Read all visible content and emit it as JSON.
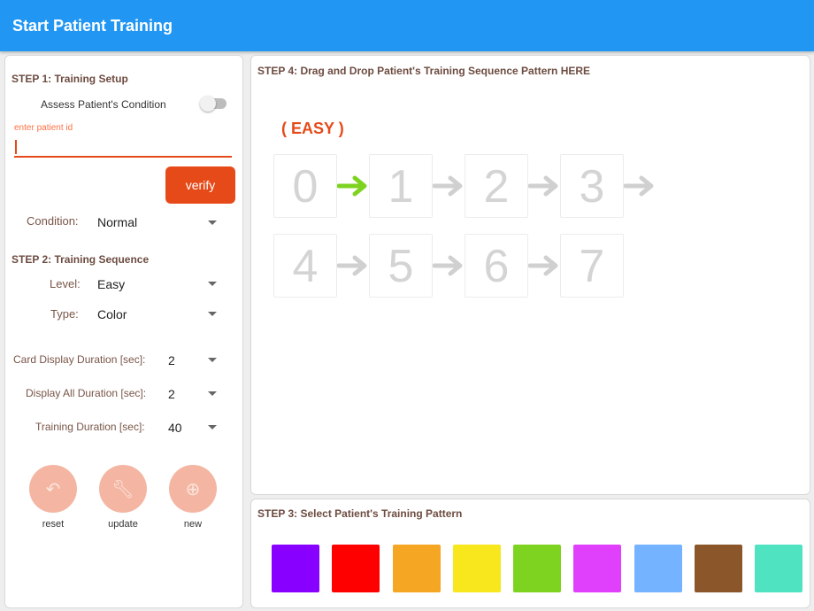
{
  "header": {
    "title": "Start Patient Training"
  },
  "setup": {
    "step1_title": "STEP 1: Training Setup",
    "assess_label": "Assess Patient's Condition",
    "assess_on": false,
    "patient_id_placeholder": "enter patient id",
    "patient_id_value": "",
    "verify_label": "verify",
    "condition_label": "Condition:",
    "condition_value": "Normal",
    "step2_title": "STEP 2: Training Sequence",
    "level_label": "Level:",
    "level_value": "Easy",
    "type_label": "Type:",
    "type_value": "Color",
    "card_display_label": "Card Display Duration [sec]:",
    "card_display_value": "2",
    "display_all_label": "Display All Duration [sec]:",
    "display_all_value": "2",
    "training_label": "Training Duration [sec]:",
    "training_value": "40",
    "buttons": [
      {
        "label": "reset",
        "icon": "undo-icon"
      },
      {
        "label": "update",
        "icon": "wrench-icon"
      },
      {
        "label": "new",
        "icon": "add-circle-icon"
      }
    ]
  },
  "sequence": {
    "step4_title": "STEP 4: Drag and Drop Patient's Training Sequence Pattern HERE",
    "level_badge": "( EASY )",
    "cards": [
      "0",
      "1",
      "2",
      "3",
      "4",
      "5",
      "6",
      "7"
    ],
    "active_arrow_index": 0
  },
  "pattern": {
    "step3_title": "STEP 3: Select Patient's Training Pattern",
    "colors": [
      "#8800ff",
      "#ff0000",
      "#f5a623",
      "#f8e71c",
      "#7ed321",
      "#e040fb",
      "#74b3ff",
      "#8b572a",
      "#50e3c2"
    ]
  },
  "theme": {
    "primary": "#2196f3",
    "accent": "#e64a19",
    "arrow_active": "#7ed321",
    "arrow_inactive": "#d0d0d0"
  }
}
